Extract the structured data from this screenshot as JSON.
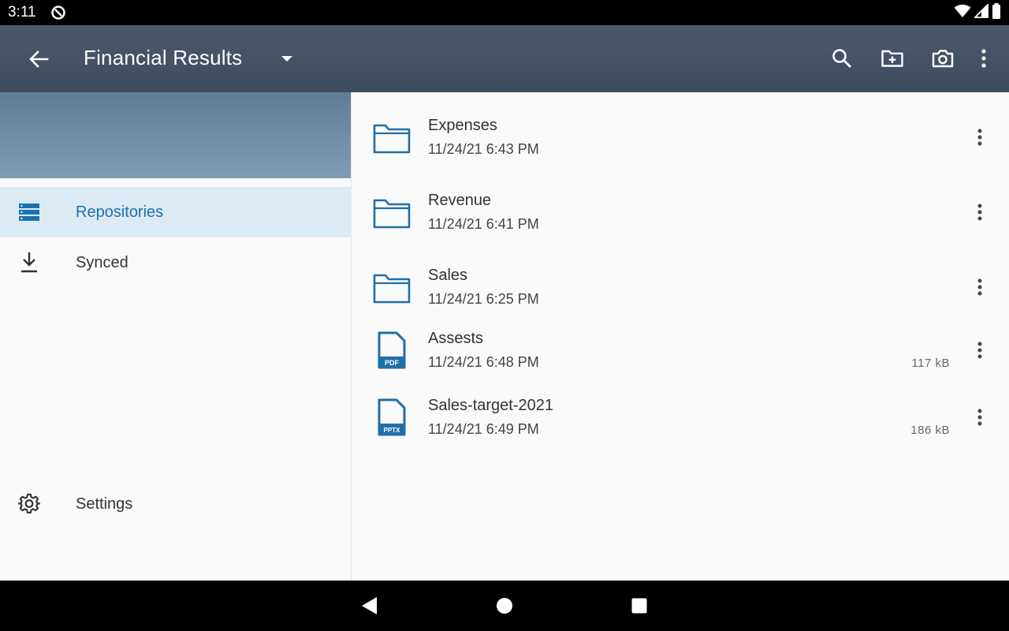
{
  "status_bar": {
    "time": "3:11",
    "icons": [
      "data-saver-icon",
      "wifi-icon",
      "signal-icon",
      "battery-icon"
    ]
  },
  "app_bar": {
    "title": "Financial Results",
    "icons": [
      "back-arrow-icon",
      "dropdown-caret-icon",
      "search-icon",
      "new-folder-icon",
      "camera-icon",
      "more-vert-icon"
    ]
  },
  "sidebar": {
    "items": [
      {
        "label": "Repositories",
        "icon": "repositories-icon",
        "active": true
      },
      {
        "label": "Synced",
        "icon": "download-icon",
        "active": false
      },
      {
        "label": "Settings",
        "icon": "gear-icon",
        "active": false
      }
    ]
  },
  "files": [
    {
      "name": "Expenses",
      "date": "11/24/21 6:43 PM",
      "type": "folder",
      "size": ""
    },
    {
      "name": "Revenue",
      "date": "11/24/21 6:41 PM",
      "type": "folder",
      "size": ""
    },
    {
      "name": "Sales",
      "date": "11/24/21 6:25 PM",
      "type": "folder",
      "size": ""
    },
    {
      "name": "Assests",
      "date": "11/24/21 6:48 PM",
      "type": "file",
      "badge": "PDF",
      "size": "117 kB"
    },
    {
      "name": "Sales-target-2021",
      "date": "11/24/21 6:49 PM",
      "type": "file",
      "badge": "PPTX",
      "size": "186 kB"
    }
  ],
  "colors": {
    "accent": "#1a73b0",
    "app_bar": "#44546a",
    "active_nav_bg": "#dceaf3",
    "icon_blue": "#1f6fa8"
  }
}
